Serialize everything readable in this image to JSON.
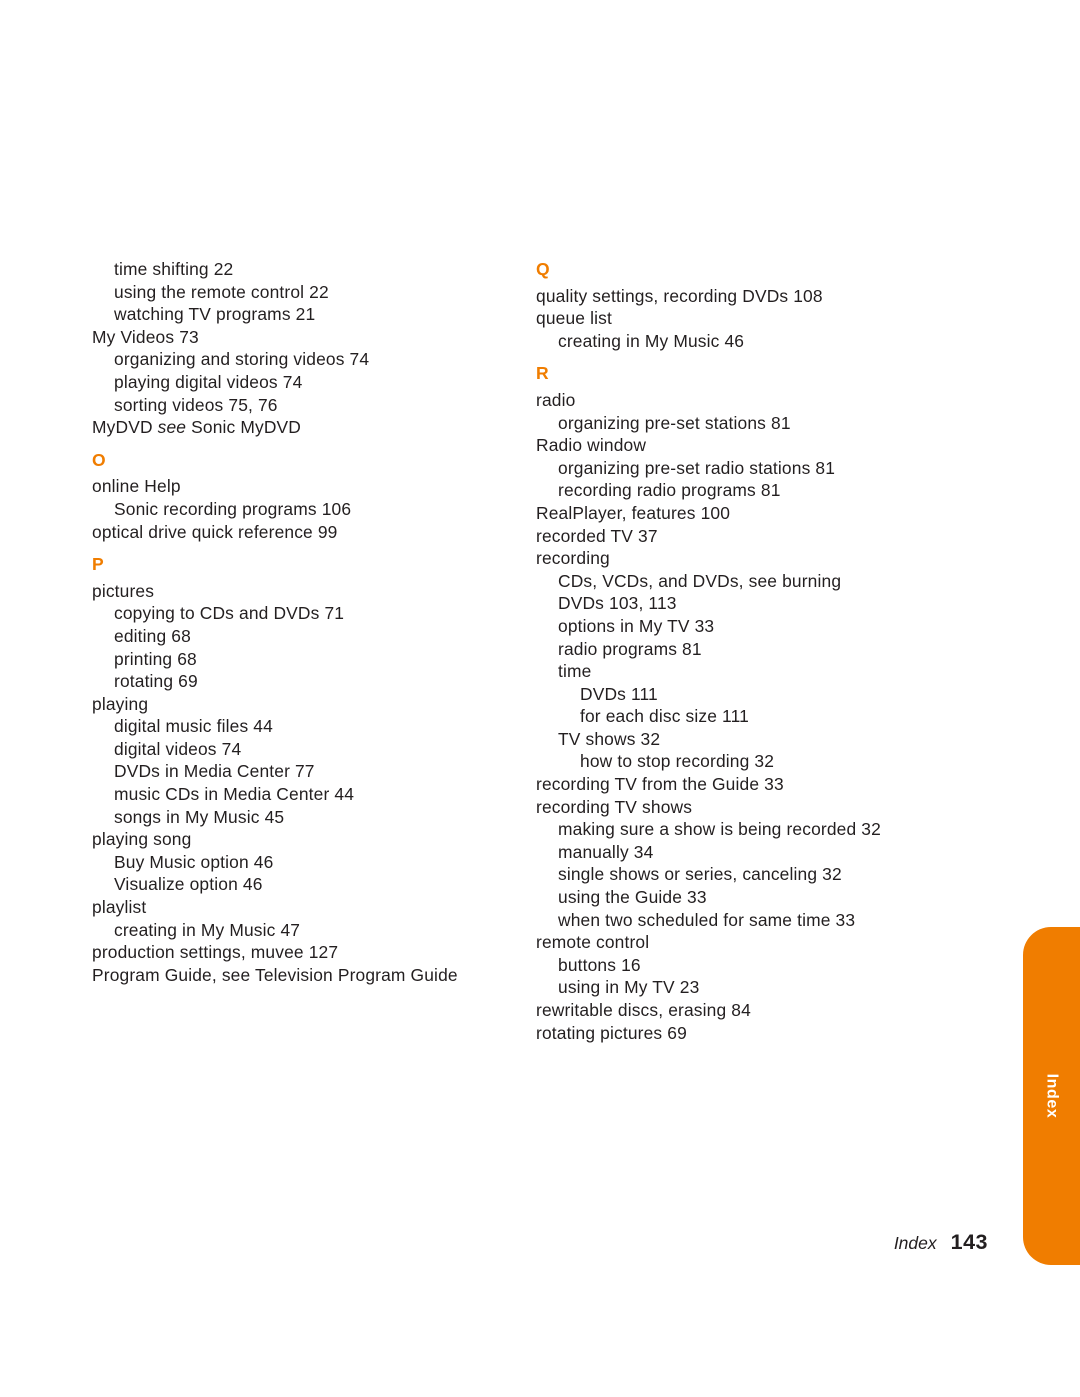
{
  "document": {
    "type": "book-index-page",
    "footer": {
      "label": "Index",
      "page_number": "143"
    },
    "side_tab": {
      "label": "Index",
      "color": "#f07d00"
    },
    "letter_heading_color": "#f07d00"
  },
  "left_column": [
    {
      "kind": "entry",
      "level": 1,
      "text": "time shifting 22"
    },
    {
      "kind": "entry",
      "level": 1,
      "text": "using the remote control 22"
    },
    {
      "kind": "entry",
      "level": 1,
      "text": "watching TV programs 21"
    },
    {
      "kind": "entry",
      "level": 0,
      "text": "My Videos 73"
    },
    {
      "kind": "entry",
      "level": 1,
      "text": "organizing and storing videos 74"
    },
    {
      "kind": "entry",
      "level": 1,
      "text": "playing digital videos 74"
    },
    {
      "kind": "entry",
      "level": 1,
      "text": "sorting videos 75, 76"
    },
    {
      "kind": "entry-italic-see",
      "level": 0,
      "text": "MyDVD ",
      "italic": "see",
      "tail": " Sonic MyDVD"
    },
    {
      "kind": "letter",
      "text": "O"
    },
    {
      "kind": "entry",
      "level": 0,
      "text": "online Help"
    },
    {
      "kind": "entry",
      "level": 1,
      "text": "Sonic recording programs 106"
    },
    {
      "kind": "entry",
      "level": 0,
      "text": "optical drive quick reference 99"
    },
    {
      "kind": "letter",
      "text": "P"
    },
    {
      "kind": "entry",
      "level": 0,
      "text": "pictures"
    },
    {
      "kind": "entry",
      "level": 1,
      "text": "copying to CDs and DVDs 71"
    },
    {
      "kind": "entry",
      "level": 1,
      "text": "editing 68"
    },
    {
      "kind": "entry",
      "level": 1,
      "text": "printing 68"
    },
    {
      "kind": "entry",
      "level": 1,
      "text": "rotating 69"
    },
    {
      "kind": "entry",
      "level": 0,
      "text": "playing"
    },
    {
      "kind": "entry",
      "level": 1,
      "text": "digital music files 44"
    },
    {
      "kind": "entry",
      "level": 1,
      "text": "digital videos 74"
    },
    {
      "kind": "entry",
      "level": 1,
      "text": "DVDs in Media Center 77"
    },
    {
      "kind": "entry",
      "level": 1,
      "text": "music CDs in Media Center 44"
    },
    {
      "kind": "entry",
      "level": 1,
      "text": "songs in My Music 45"
    },
    {
      "kind": "entry",
      "level": 0,
      "text": "playing song"
    },
    {
      "kind": "entry",
      "level": 1,
      "text": "Buy Music option 46"
    },
    {
      "kind": "entry",
      "level": 1,
      "text": "Visualize option 46"
    },
    {
      "kind": "entry",
      "level": 0,
      "text": "playlist"
    },
    {
      "kind": "entry",
      "level": 1,
      "text": "creating in My Music 47"
    },
    {
      "kind": "entry",
      "level": 0,
      "text": "production settings, muvee 127"
    },
    {
      "kind": "entry",
      "level": 0,
      "text": "Program Guide, see Television Program Guide"
    }
  ],
  "right_column": [
    {
      "kind": "letter",
      "text": "Q"
    },
    {
      "kind": "entry",
      "level": 0,
      "text": "quality settings, recording DVDs 108"
    },
    {
      "kind": "entry",
      "level": 0,
      "text": "queue list"
    },
    {
      "kind": "entry",
      "level": 1,
      "text": "creating in My Music 46"
    },
    {
      "kind": "letter",
      "text": "R"
    },
    {
      "kind": "entry",
      "level": 0,
      "text": "radio"
    },
    {
      "kind": "entry",
      "level": 1,
      "text": "organizing pre-set stations 81"
    },
    {
      "kind": "entry",
      "level": 0,
      "text": "Radio window"
    },
    {
      "kind": "entry",
      "level": 1,
      "text": "organizing pre-set radio stations 81"
    },
    {
      "kind": "entry",
      "level": 1,
      "text": "recording radio programs 81"
    },
    {
      "kind": "entry",
      "level": 0,
      "text": "RealPlayer, features 100"
    },
    {
      "kind": "entry",
      "level": 0,
      "text": "recorded TV 37"
    },
    {
      "kind": "entry",
      "level": 0,
      "text": "recording"
    },
    {
      "kind": "entry",
      "level": 1,
      "text": "CDs, VCDs, and DVDs, see burning"
    },
    {
      "kind": "entry",
      "level": 1,
      "text": "DVDs 103, 113"
    },
    {
      "kind": "entry",
      "level": 1,
      "text": "options in My TV 33"
    },
    {
      "kind": "entry",
      "level": 1,
      "text": "radio programs 81"
    },
    {
      "kind": "entry",
      "level": 1,
      "text": "time"
    },
    {
      "kind": "entry",
      "level": 2,
      "text": "DVDs 111"
    },
    {
      "kind": "entry",
      "level": 2,
      "text": "for each disc size 111"
    },
    {
      "kind": "entry",
      "level": 1,
      "text": "TV shows 32"
    },
    {
      "kind": "entry",
      "level": 2,
      "text": "how to stop recording 32"
    },
    {
      "kind": "entry",
      "level": 0,
      "text": "recording TV from the Guide 33"
    },
    {
      "kind": "entry",
      "level": 0,
      "text": "recording TV shows"
    },
    {
      "kind": "entry",
      "level": 1,
      "text": "making sure a show is being recorded 32"
    },
    {
      "kind": "entry",
      "level": 1,
      "text": "manually 34"
    },
    {
      "kind": "entry",
      "level": 1,
      "text": "single shows or series, canceling 32"
    },
    {
      "kind": "entry",
      "level": 1,
      "text": "using the Guide 33"
    },
    {
      "kind": "entry",
      "level": 1,
      "text": "when two scheduled for same time 33"
    },
    {
      "kind": "entry",
      "level": 0,
      "text": "remote control"
    },
    {
      "kind": "entry",
      "level": 1,
      "text": "buttons 16"
    },
    {
      "kind": "entry",
      "level": 1,
      "text": "using in My TV 23"
    },
    {
      "kind": "entry",
      "level": 0,
      "text": "rewritable discs, erasing 84"
    },
    {
      "kind": "entry",
      "level": 0,
      "text": "rotating pictures 69"
    }
  ]
}
